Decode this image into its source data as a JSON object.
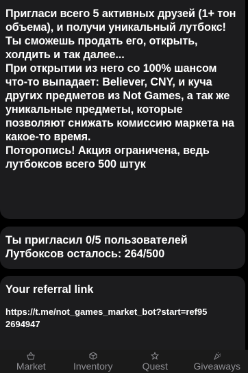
{
  "promo": {
    "text": "Пригласи всего 5 активных друзей (1+ тон объема), и получи уникальный лутбокс! Ты сможешь продать его, открыть, холдить и так далее...\nПри открытии из него со 100% шансом что-то выпадает: Believer, CNY, и куча других предметов из Not Games, а так же уникальные предметы, которые позволяют снижать комиссию маркета на какое-то время.\nПоторопись! Акция ограничена, ведь лутбоксов всего 500 штук"
  },
  "stats": {
    "invited": "Ты пригласил 0/5 пользователей",
    "remaining": "Лутбоксов осталось: 264/500"
  },
  "referral": {
    "title": "Your referral link",
    "link": "https://t.me/not_games_market_bot?start=ref952694947"
  },
  "tabs": [
    {
      "label": "Market",
      "icon": "basket-icon"
    },
    {
      "label": "Inventory",
      "icon": "box-icon"
    },
    {
      "label": "Quest",
      "icon": "star-icon"
    },
    {
      "label": "Giveaways",
      "icon": "party-icon"
    }
  ],
  "colors": {
    "background": "#000000",
    "card": "#1c1c1e",
    "tab_inactive": "#8e8e93"
  }
}
